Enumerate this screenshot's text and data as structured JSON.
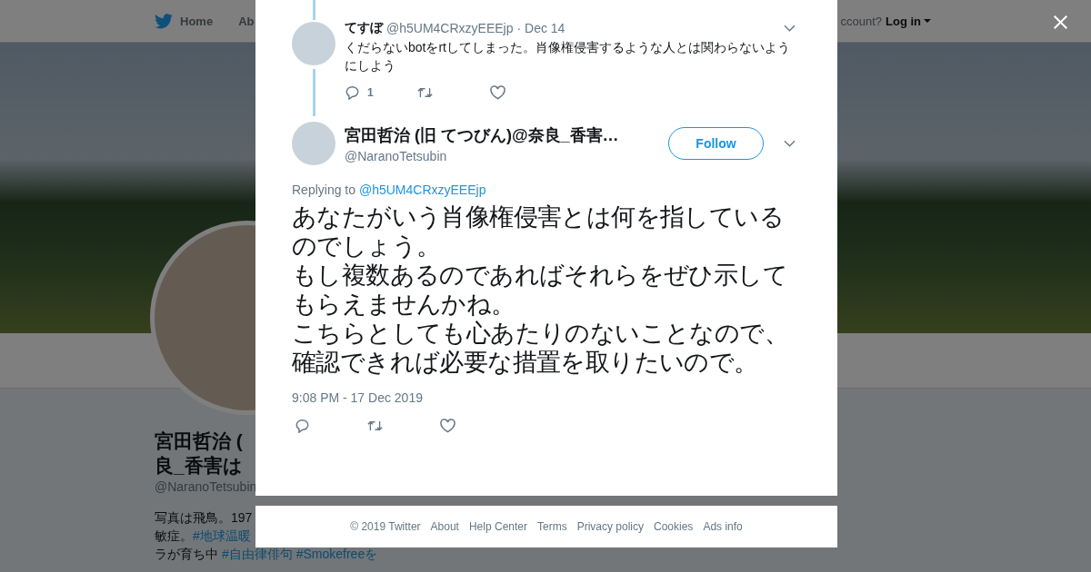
{
  "background_page": {
    "nav": {
      "home": "Home",
      "about": "Ab",
      "account_prompt": "ccount?",
      "login": "Log in"
    },
    "profile": {
      "name_lines": [
        "宮田哲治 (",
        "良_香害は"
      ],
      "handle": "@NaranoTetsubin",
      "bio_lines": [
        [
          {
            "kind": "text",
            "text": "写真は飛鳥。197"
          }
        ],
        [
          {
            "kind": "text",
            "text": "敏症。"
          },
          {
            "kind": "hashtag",
            "text": "#地球温暖"
          }
        ],
        [
          {
            "kind": "text",
            "text": "ラが育ち中 "
          },
          {
            "kind": "hashtag",
            "text": "#自由律俳句"
          },
          {
            "kind": "hashtag",
            "text": "#Smokefreeを"
          }
        ]
      ]
    }
  },
  "modal": {
    "parent_tweet": {
      "name": "てすぼ",
      "handle": "@h5UM4CRxzyEEEjp",
      "date": "· Dec 14",
      "text": "くだらないbotをrtしてしまった。肖像権侵害するような人とは関わらないようにしよう",
      "actions": [
        {
          "kind": "reply",
          "count": "1"
        },
        {
          "kind": "retweet"
        },
        {
          "kind": "like"
        }
      ]
    },
    "tweet": {
      "name": "宮田哲治 (旧 てつびん)@奈良_香害…",
      "handle": "@NaranoTetsubin",
      "follow_button": "Follow",
      "replying_label": "Replying to",
      "replying_handle": "@h5UM4CRxzyEEEjp",
      "text_paragraphs": [
        "あなたがいう肖像権侵害とは何を指しているのでしょう。",
        "もし複数あるのであればそれらをぜひ示してもらえませんかね。",
        "こちらとしても心あたりのないことなので、確認できれば必要な措置を取りたいので。"
      ],
      "timestamp": "9:08 PM - 17 Dec 2019",
      "actions": [
        {
          "kind": "reply"
        },
        {
          "kind": "retweet"
        },
        {
          "kind": "like"
        }
      ]
    }
  },
  "footer": {
    "links": [
      "© 2019 Twitter",
      "About",
      "Help Center",
      "Terms",
      "Privacy policy",
      "Cookies",
      "Ads info"
    ]
  }
}
